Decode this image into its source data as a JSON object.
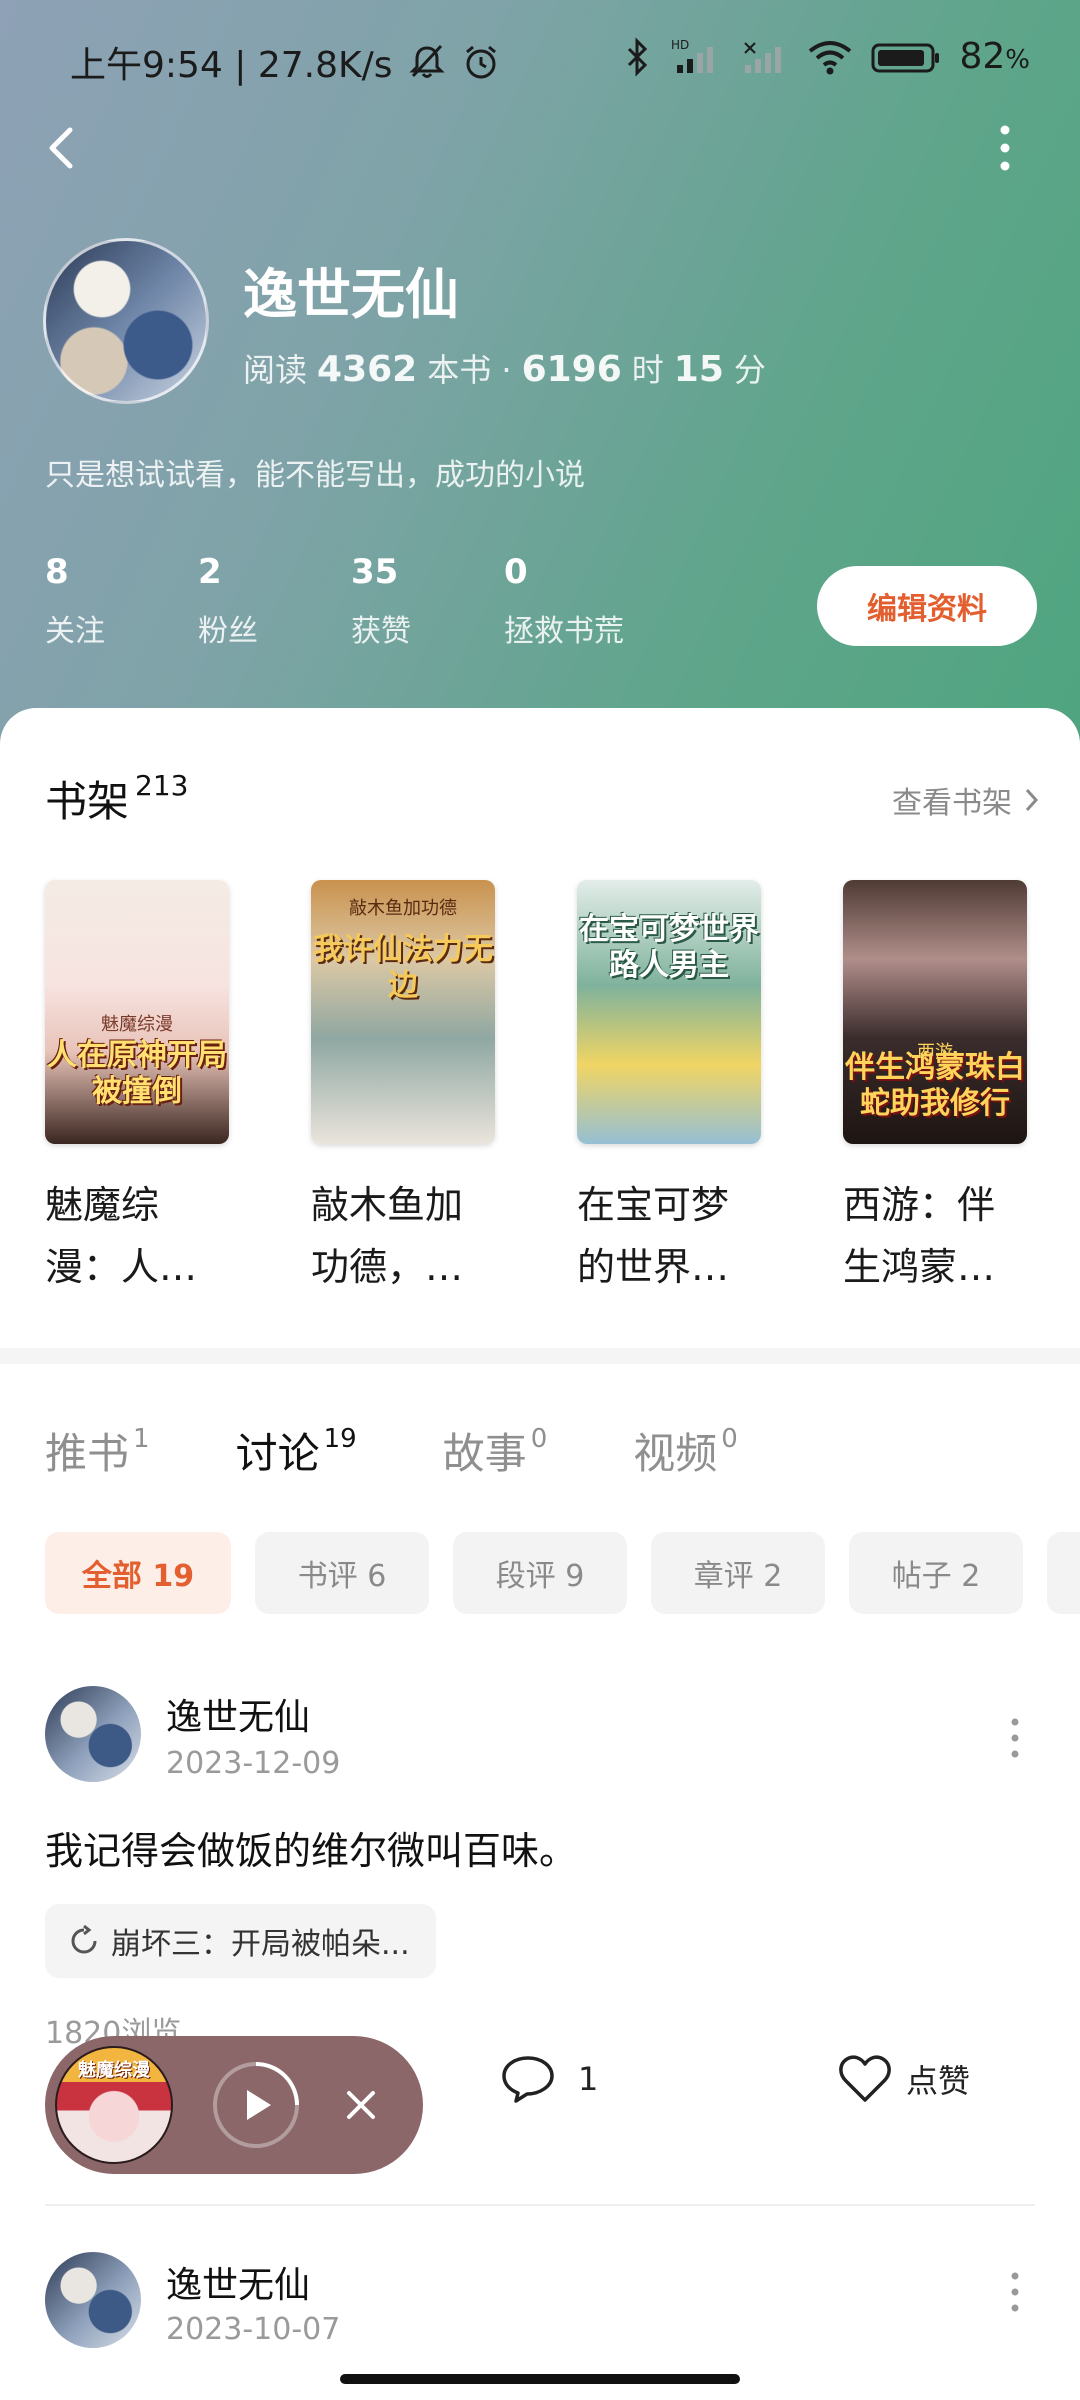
{
  "status_bar": {
    "time_speed": "上午9:54 | 27.8K/s",
    "battery": "82",
    "battery_unit": "%",
    "icons": [
      "mute-bell-icon",
      "alarm-icon",
      "bluetooth-icon",
      "signal-hd-icon",
      "signal-icon",
      "wifi-icon",
      "battery-icon"
    ]
  },
  "profile": {
    "name": "逸世无仙",
    "read_label_1": "阅读",
    "books_count": "4362",
    "read_label_2": "本书 ·",
    "hours": "6196",
    "read_label_3": "时",
    "minutes": "15",
    "read_label_4": "分",
    "bio": "只是想试试看，能不能写出，成功的小说",
    "stats": [
      {
        "value": "8",
        "label": "关注"
      },
      {
        "value": "2",
        "label": "粉丝"
      },
      {
        "value": "35",
        "label": "获赞"
      },
      {
        "value": "0",
        "label": "拯救书荒"
      }
    ],
    "edit_label": "编辑资料"
  },
  "shelf": {
    "title": "书架",
    "count": "213",
    "link": "查看书架",
    "books": [
      {
        "title_line1": "魅魔综",
        "title_line2": "漫：人…",
        "cover_text": "人在原神开局被撞倒",
        "cover_top": "魅魔综漫"
      },
      {
        "title_line1": "敲木鱼加",
        "title_line2": "功德，…",
        "cover_text": "我许仙法力无边",
        "cover_top": "敲木鱼加功德"
      },
      {
        "title_line1": "在宝可梦",
        "title_line2": "的世界…",
        "cover_text": "在宝可梦世界路人男主",
        "cover_top": ""
      },
      {
        "title_line1": "西游：伴",
        "title_line2": "生鸿蒙…",
        "cover_text": "伴生鸿蒙珠白蛇助我修行",
        "cover_top": "西游"
      }
    ]
  },
  "tabs": [
    {
      "label": "推书",
      "count": "1"
    },
    {
      "label": "讨论",
      "count": "19"
    },
    {
      "label": "故事",
      "count": "0"
    },
    {
      "label": "视频",
      "count": "0"
    }
  ],
  "chips": [
    {
      "label": "全部 19"
    },
    {
      "label": "书评 6"
    },
    {
      "label": "段评 9"
    },
    {
      "label": "章评 2"
    },
    {
      "label": "帖子 2"
    }
  ],
  "posts": [
    {
      "author": "逸世无仙",
      "date": "2023-12-09",
      "text": "我记得会做饭的维尔微叫百味。",
      "tag": "崩坏三：开局被帕朵...",
      "views": "1820浏览",
      "comments": "1",
      "like_label": "点赞"
    },
    {
      "author": "逸世无仙",
      "date": "2023-10-07"
    }
  ],
  "player": {
    "cover_text": "魅魔综漫"
  },
  "colors": {
    "accent": "#e35f2f",
    "header_start": "#8ea1b6",
    "header_end": "#4fa57f",
    "player_bg": "#8b6769"
  }
}
